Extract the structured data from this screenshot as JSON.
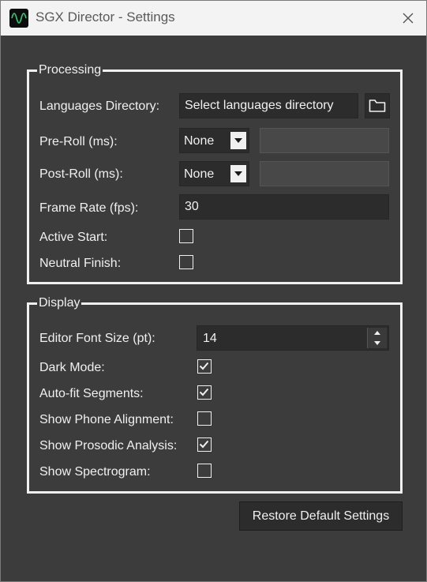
{
  "window": {
    "title": "SGX Director - Settings"
  },
  "processing": {
    "title": "Processing",
    "languages_directory": {
      "label": "Languages Directory:",
      "placeholder": "Select languages directory",
      "browse_icon": "folder-icon"
    },
    "pre_roll": {
      "label": "Pre-Roll (ms):",
      "selected": "None",
      "value": ""
    },
    "post_roll": {
      "label": "Post-Roll (ms):",
      "selected": "None",
      "value": ""
    },
    "frame_rate": {
      "label": "Frame Rate (fps):",
      "value": "30"
    },
    "active_start": {
      "label": "Active Start:",
      "checked": false
    },
    "neutral_finish": {
      "label": "Neutral Finish:",
      "checked": false
    }
  },
  "display": {
    "title": "Display",
    "editor_font_size": {
      "label": "Editor Font Size (pt):",
      "value": "14"
    },
    "dark_mode": {
      "label": "Dark Mode:",
      "checked": true
    },
    "auto_fit_segments": {
      "label": "Auto-fit Segments:",
      "checked": true
    },
    "show_phone_alignment": {
      "label": "Show Phone Alignment:",
      "checked": false
    },
    "show_prosodic_analysis": {
      "label": "Show Prosodic Analysis:",
      "checked": true
    },
    "show_spectrogram": {
      "label": "Show Spectrogram:",
      "checked": false
    }
  },
  "footer": {
    "restore_button": "Restore Default Settings"
  },
  "colors": {
    "window_bg": "#3c3c3c",
    "titlebar_bg": "#f3f3f3",
    "text": "#f0f0f0",
    "field_bg": "#2c2c2c"
  }
}
